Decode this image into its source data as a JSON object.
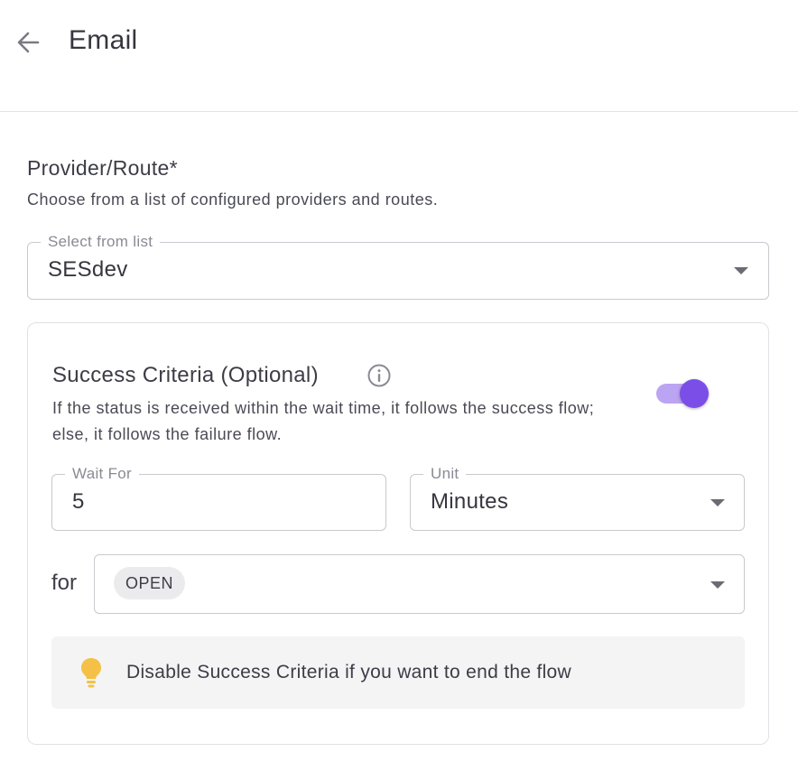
{
  "header": {
    "title": "Email"
  },
  "provider": {
    "title": "Provider/Route*",
    "description": "Choose from a list of configured providers and routes.",
    "select": {
      "legend": "Select from list",
      "value": "SESdev"
    }
  },
  "success_criteria": {
    "title": "Success Criteria (Optional)",
    "description": "If the status is received within the wait time, it follows the success flow; else, it follows the failure flow.",
    "enabled": true,
    "wait_for": {
      "legend": "Wait For",
      "value": "5"
    },
    "unit": {
      "legend": "Unit",
      "value": "Minutes"
    },
    "for_label": "for",
    "status_chips": [
      "OPEN"
    ],
    "tip": "Disable Success Criteria if you want to end the flow"
  },
  "colors": {
    "accent": "#7c4ee8",
    "accent_light": "#bba4f2",
    "tip_bulb": "#f5c046",
    "tip_background": "#f4f4f5"
  },
  "icons": {
    "back": "arrow-left-icon",
    "info": "info-circle-icon",
    "dropdown": "caret-down-icon",
    "tip": "lightbulb-icon"
  }
}
